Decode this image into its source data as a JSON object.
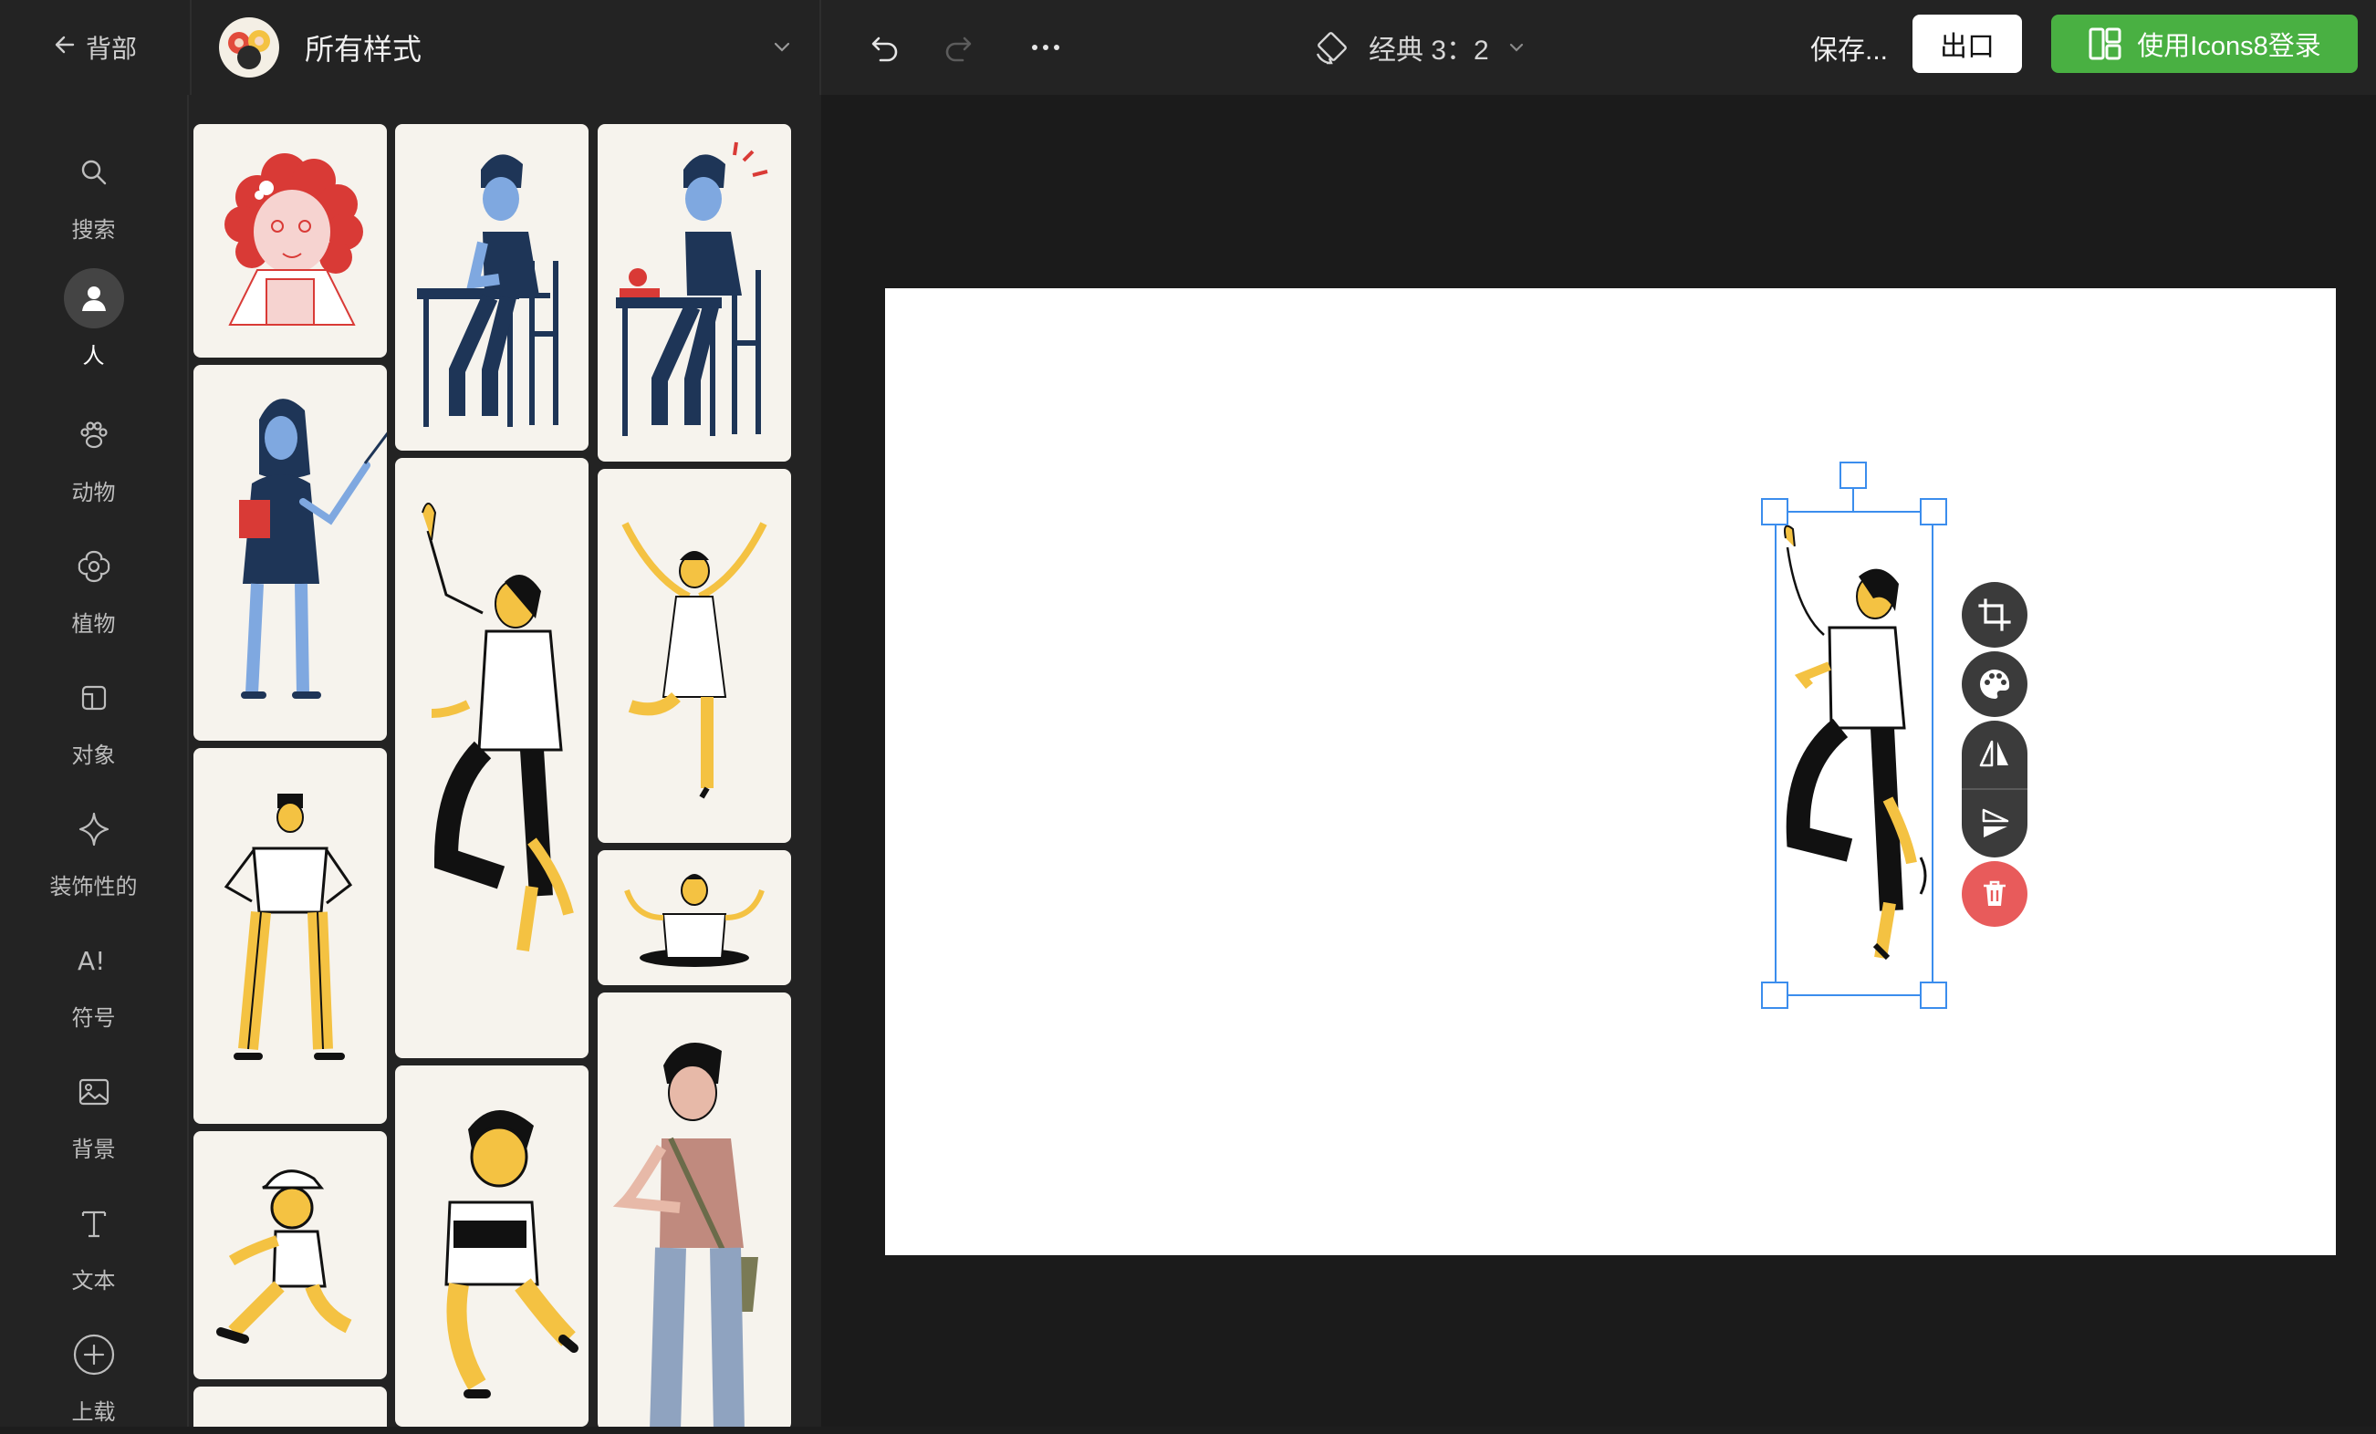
{
  "header": {
    "back_label": "背部",
    "style_title": "所有样式",
    "canvas_format": "经典 3：2",
    "save_label": "保存...",
    "export_label": "出口",
    "login_label": "使用Icons8登录"
  },
  "sidebar": {
    "items": [
      {
        "label": "搜索",
        "icon": "search-icon"
      },
      {
        "label": "人",
        "icon": "person-icon"
      },
      {
        "label": "动物",
        "icon": "paw-icon"
      },
      {
        "label": "植物",
        "icon": "flower-icon"
      },
      {
        "label": "对象",
        "icon": "object-icon"
      },
      {
        "label": "装饰性的",
        "icon": "sparkle-icon"
      },
      {
        "label": "符号",
        "icon": "symbol-icon"
      },
      {
        "label": "背景",
        "icon": "image-icon"
      },
      {
        "label": "文本",
        "icon": "text-icon"
      },
      {
        "label": "上载",
        "icon": "upload-icon"
      }
    ],
    "active_index": 1
  },
  "colors": {
    "accent_green": "#49b042",
    "selection_blue": "#3b8ded",
    "delete_red": "#e85b5b",
    "illustration_yellow": "#f4c242"
  }
}
